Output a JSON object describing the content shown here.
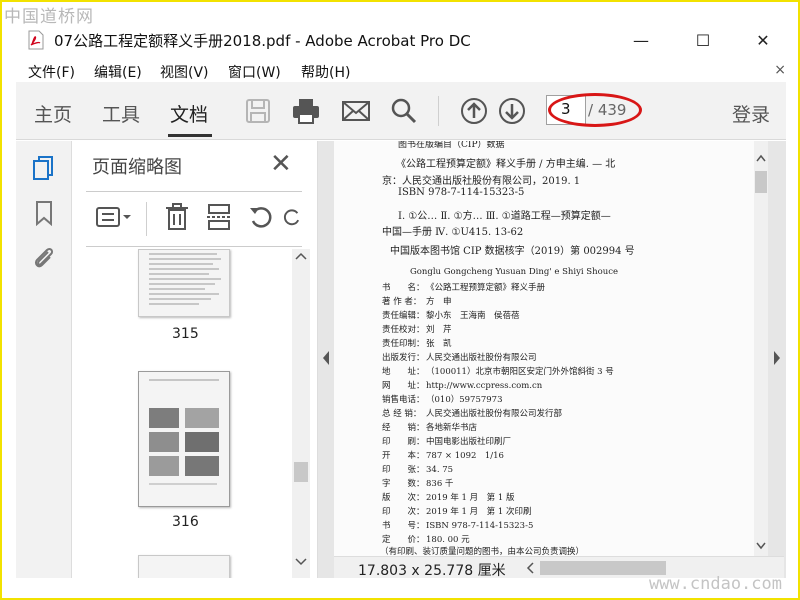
{
  "watermarks": {
    "top": "中国道桥网",
    "bottom": "www.cndao.com"
  },
  "window": {
    "title": "07公路工程定额释义手册2018.pdf - Adobe Acrobat Pro DC",
    "minimize": "—",
    "maximize": "☐",
    "close": "✕"
  },
  "menu": {
    "items": [
      "文件(F)",
      "编辑(E)",
      "视图(V)",
      "窗口(W)",
      "帮助(H)"
    ],
    "close": "×"
  },
  "toolbar": {
    "tabs": [
      "主页",
      "工具",
      "文档"
    ],
    "active_tab": "文档",
    "icons": [
      "save-icon",
      "print-icon",
      "mail-icon",
      "search-icon",
      "page-up-icon",
      "page-down-icon"
    ],
    "page_current": "3",
    "page_total": "/ 439",
    "login": "登录"
  },
  "left_rail": {
    "icons": [
      "page-thumbnails-icon",
      "bookmark-icon",
      "attachment-icon"
    ]
  },
  "thumb_panel": {
    "title": "页面缩略图",
    "close": "✕",
    "tools": [
      "options-menu-icon",
      "trash-icon",
      "insert-page-icon",
      "rotate-icon",
      "rotate-clockwise-icon"
    ],
    "pages": [
      "315",
      "316"
    ]
  },
  "document": {
    "cip_header": "图书在版编目（CIP）数据",
    "cip_lines": [
      "《公路工程预算定额》释义手册 / 方申主编. — 北",
      "京：人民交通出版社股份有限公司，2019. 1",
      "ISBN 978-7-114-15323-5",
      "Ⅰ. ①公…  Ⅱ. ①方…  Ⅲ. ①道路工程—预算定额—",
      "中国—手册  Ⅳ. ①U415. 13-62",
      "中国版本图书馆 CIP 数据核字（2019）第 002994 号"
    ],
    "pinyin": "Gonglu Gongcheng Yusuan Ding' e Shiyi Shouce",
    "rows": [
      {
        "label": "书　　名：",
        "value": "《公路工程预算定额》释义手册"
      },
      {
        "label": "著 作 者：",
        "value": "方　申"
      },
      {
        "label": "责任编辑：",
        "value": "黎小东　王海南　侯蓓蓓"
      },
      {
        "label": "责任校对：",
        "value": "刘　芹"
      },
      {
        "label": "责任印制：",
        "value": "张　凯"
      },
      {
        "label": "出版发行：",
        "value": "人民交通出版社股份有限公司"
      },
      {
        "label": "地　　址：",
        "value": "（100011）北京市朝阳区安定门外外馆斜街 3 号"
      },
      {
        "label": "网　　址：",
        "value": "http://www.ccpress.com.cn"
      },
      {
        "label": "销售电话：",
        "value": "（010）59757973"
      },
      {
        "label": "总 经 销：",
        "value": "人民交通出版社股份有限公司发行部"
      },
      {
        "label": "经　　销：",
        "value": "各地新华书店"
      },
      {
        "label": "印　　刷：",
        "value": "中国电影出版社印刷厂"
      },
      {
        "label": "开　　本：",
        "value": "787 × 1092　1/16"
      },
      {
        "label": "印　　张：",
        "value": "34. 75"
      },
      {
        "label": "字　　数：",
        "value": "836 千"
      },
      {
        "label": "版　　次：",
        "value": "2019 年 1 月　第 1 版"
      },
      {
        "label": "印　　次：",
        "value": "2019 年 1 月　第 1 次印刷"
      },
      {
        "label": "书　　号：",
        "value": "ISBN 978-7-114-15323-5"
      },
      {
        "label": "定　　价：",
        "value": "180. 00 元"
      }
    ],
    "footer_note": "（有印刷、装订质量问题的图书，由本公司负责调换）",
    "page_size": "17.803 x 25.778 厘米"
  },
  "colors": {
    "highlight": "#d81616",
    "frame": "#f2e200",
    "toolbar_bg": "#f2f2f2"
  }
}
